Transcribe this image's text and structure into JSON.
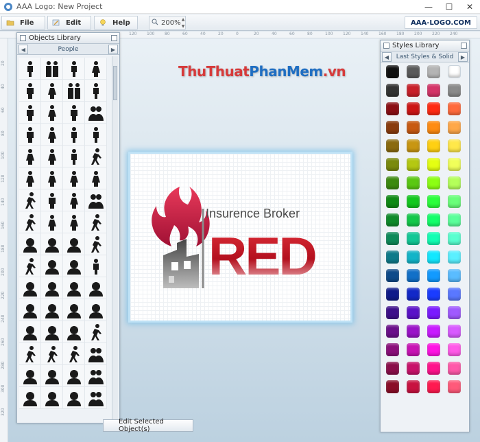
{
  "window": {
    "title": "AAA Logo: New Project"
  },
  "toolbar": {
    "file_label": "File",
    "edit_label": "Edit",
    "help_label": "Help",
    "zoom_value": "200%",
    "brand_label": "AAA-LOGO.COM"
  },
  "rulers": {
    "top": [
      "120",
      "100",
      "80",
      "60",
      "40",
      "20",
      "0",
      "20",
      "40",
      "60",
      "80",
      "100",
      "120",
      "140",
      "160",
      "180",
      "200",
      "220",
      "240"
    ],
    "left": [
      "20",
      "40",
      "60",
      "80",
      "100",
      "120",
      "140",
      "160",
      "180",
      "200",
      "220",
      "240",
      "260",
      "280",
      "300",
      "320"
    ]
  },
  "objects_library": {
    "title": "Objects Library",
    "category": "People",
    "icons": [
      "person-standing-icon",
      "couple-icon",
      "person-icon",
      "woman-icon",
      "man-icon",
      "woman-icon",
      "user-pair-icon",
      "person-icon",
      "man-icon",
      "woman-icon",
      "man-icon",
      "family-icon",
      "man-icon",
      "woman-icon",
      "person-icon",
      "person-icon",
      "woman-icon",
      "child-icon",
      "person-icon",
      "runner-icon",
      "woman-icon",
      "child-icon",
      "baby-icon",
      "woman-icon",
      "guide-icon",
      "man-icon",
      "woman-icon",
      "family-icon",
      "walker-icon",
      "woman-icon",
      "child-icon",
      "elderly-icon",
      "woman-avatar-icon",
      "woman-avatar-icon",
      "woman-avatar-icon",
      "sitting-icon",
      "dancer-icon",
      "woman-avatar-icon",
      "user-avatar-icon",
      "person-icon",
      "head-profile-icon",
      "man-avatar-icon",
      "man-avatar-icon",
      "woman-avatar-icon",
      "woman-avatar-icon",
      "woman-avatar-icon",
      "woman-avatar-icon",
      "woman-avatar-icon",
      "woman-avatar-icon",
      "woman-avatar-icon",
      "man-avatar-icon",
      "acrobat-icon",
      "walker-icon",
      "blind-icon",
      "runner-icon",
      "group-icon",
      "user-icon",
      "user-icon",
      "user-icon",
      "group-icon",
      "user-icon",
      "user-icon",
      "user-icon",
      "group-icon"
    ]
  },
  "styles_library": {
    "title": "Styles Library",
    "category": "Last Styles & Solid",
    "swatches": [
      "#111111",
      "#5a5a5a",
      "#b4b4b4",
      "#ffffff",
      "#333333",
      "#c8202a",
      "#d43468",
      "#8a8a8a",
      "#8a0e14",
      "#cc1515",
      "#ff2a12",
      "#ff6a3c",
      "#8a3c0e",
      "#c85a12",
      "#ff8c12",
      "#ffa84a",
      "#8a6a0e",
      "#c89612",
      "#ffd012",
      "#ffe84a",
      "#7a8a0e",
      "#b4c812",
      "#e4ff12",
      "#f0ff5a",
      "#3c8a0e",
      "#5ac812",
      "#8cff12",
      "#b4ff5a",
      "#0e8a14",
      "#12c81e",
      "#2aff3c",
      "#6aff7a",
      "#0e8a2a",
      "#12c84a",
      "#12ff6a",
      "#5aff9a",
      "#0e8a5a",
      "#12c896",
      "#12ffb4",
      "#5affd0",
      "#0e7a8a",
      "#12b4c8",
      "#12e8ff",
      "#5af0ff",
      "#0e4a8a",
      "#1270c8",
      "#129aff",
      "#5abcff",
      "#0e1a8a",
      "#1228c8",
      "#1a3cff",
      "#5a78ff",
      "#3c0e8a",
      "#5a12c8",
      "#7a1aff",
      "#a05aff",
      "#6a0e8a",
      "#9a12c8",
      "#c81aff",
      "#d85aff",
      "#8a0e7a",
      "#c812b4",
      "#ff12e4",
      "#ff5ae8",
      "#8a0e4a",
      "#c8126a",
      "#ff128c",
      "#ff5aaa",
      "#8a0e28",
      "#c81240",
      "#ff1a50",
      "#ff5a7a"
    ]
  },
  "canvas": {
    "logo_tagline": "Insurence Broker",
    "logo_word": "RED",
    "colors": {
      "flame": "#c4183a",
      "word": "#c81e28",
      "building": "#5a5a5a"
    }
  },
  "watermark": {
    "part1": "ThuThuat",
    "part2": "PhanMem",
    "part3": ".vn"
  },
  "edit_selected_label": "Edit Selected Object(s)"
}
